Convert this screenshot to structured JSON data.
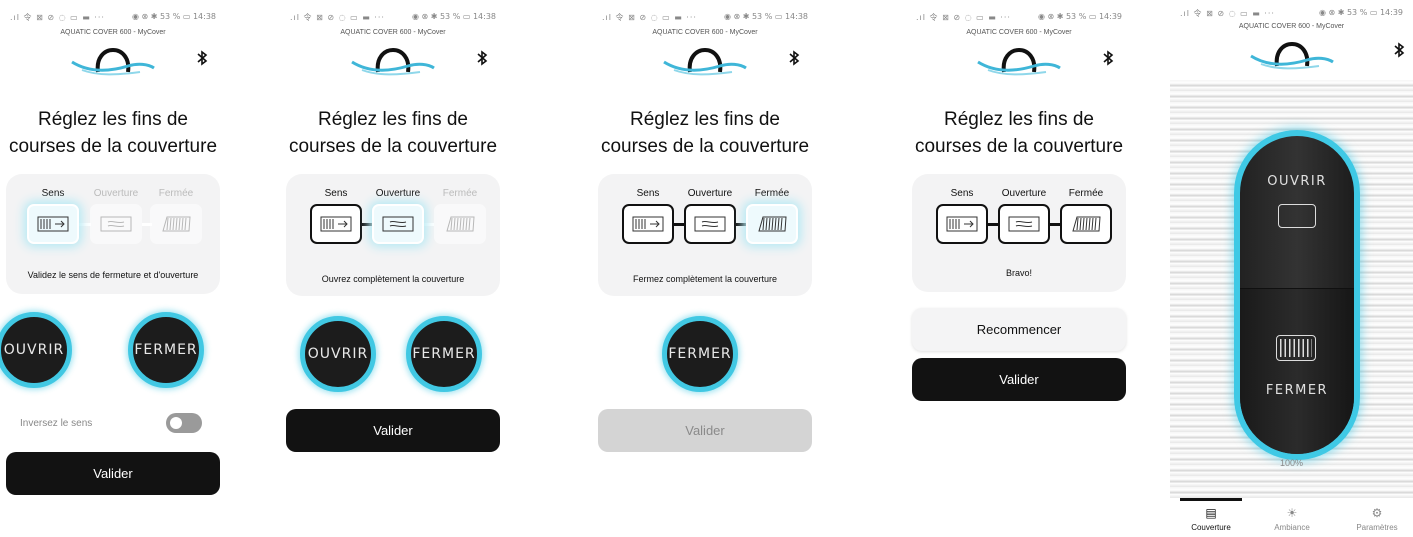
{
  "common": {
    "device_title": "AQUATIC COVER 600 - MyCover",
    "heading_line1": "Réglez les fins de",
    "heading_line2": "courses de la couverture",
    "step_sens": "Sens",
    "step_ouverture": "Ouverture",
    "step_fermee": "Fermée",
    "open_label": "OUVRIR",
    "close_label": "FERMER",
    "validate_label": "Valider",
    "status_left": ".ıl 令 ⊠ ⊘ ◌ ▭ ▬ ···",
    "status_right_438": "◉ ⊗ ✱ 53 % ▭ 14:38",
    "status_right_439": "◉ ⊗ ✱ 53 % ▭ 14:39"
  },
  "screen1": {
    "message": "Validez le sens de fermeture et d'ouverture",
    "toggle_label": "Inversez le sens",
    "toggle_on": false
  },
  "screen2": {
    "message": "Ouvrez complètement la couverture"
  },
  "screen3": {
    "message": "Fermez complètement la couverture"
  },
  "screen4": {
    "message": "Bravo!",
    "restart_label": "Recommencer"
  },
  "screen5": {
    "percent": "100%",
    "tabs": [
      {
        "label": "Couverture",
        "icon": "cover-icon"
      },
      {
        "label": "Ambiance",
        "icon": "bulb-icon"
      },
      {
        "label": "Paramètres",
        "icon": "gear-icon"
      }
    ]
  },
  "colors": {
    "accent": "#41c8e3",
    "glow": "#b5e9f3",
    "dark": "#121212",
    "card": "#f3f3f4"
  }
}
